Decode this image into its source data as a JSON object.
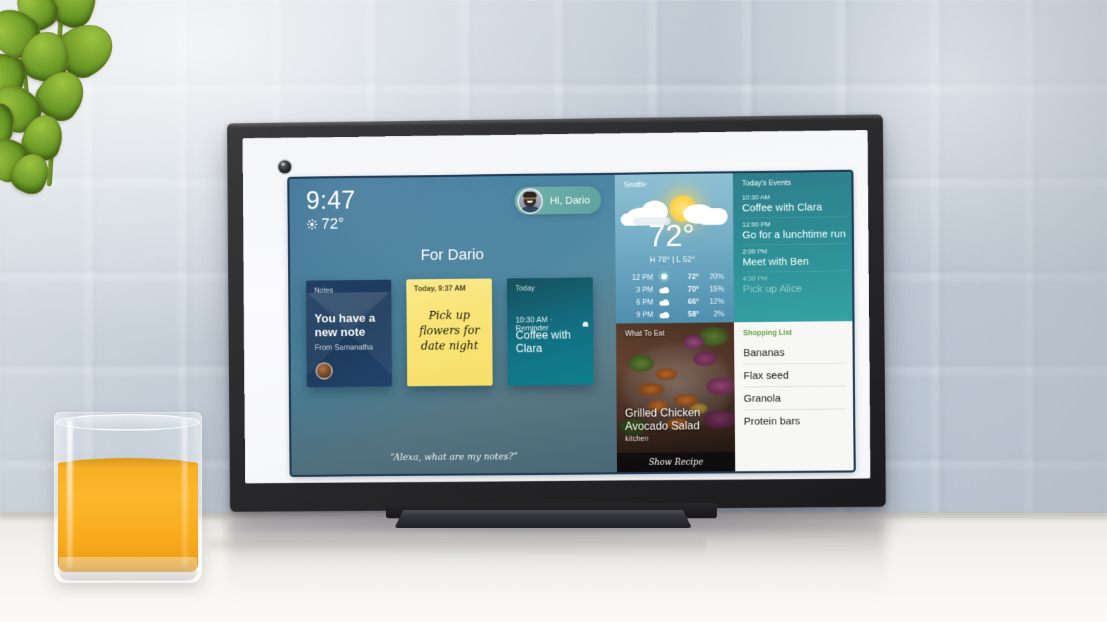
{
  "device": {
    "name": "Echo Show smart display",
    "camera_icon": "camera-lens-icon"
  },
  "screen": {
    "home": {
      "clock": {
        "time": "9:47",
        "temperature": "72°",
        "weather_icon": "sun-icon"
      },
      "greeting": {
        "text": "Hi, Dario",
        "avatar_icon": "user-avatar"
      },
      "section_title": "For Dario",
      "cards": [
        {
          "kicker": "Notes",
          "headline": "You have a new note",
          "subtext": "From Samanatha",
          "type": "note",
          "icon": "envelope-icon",
          "avatar_icon": "sender-avatar"
        },
        {
          "kicker": "Today, 9:37 AM",
          "headline": "Pick up flowers for date night",
          "type": "sticky-note"
        },
        {
          "kicker": "Today",
          "meta": "10:30 AM · Reminder",
          "headline": "Coffee with Clara",
          "type": "reminder",
          "icon": "bell-icon"
        }
      ],
      "voice_hint": "“Alexa, what are my notes?”"
    },
    "weather": {
      "city": "Seattle",
      "current_temp": "72°",
      "high_low": "H 78° | L 52°",
      "condition_icon": "partly-cloudy-sun-icon",
      "hourly": [
        {
          "time": "12 PM",
          "icon": "sun-icon",
          "temp": "72°",
          "precip": "20%"
        },
        {
          "time": "3 PM",
          "icon": "partly-cloudy-icon",
          "temp": "70°",
          "precip": "15%"
        },
        {
          "time": "6 PM",
          "icon": "partly-cloudy-icon",
          "temp": "66°",
          "precip": "12%"
        },
        {
          "time": "9 PM",
          "icon": "partly-cloudy-icon",
          "temp": "58°",
          "precip": "2%"
        }
      ]
    },
    "events": {
      "title": "Today's Events",
      "items": [
        {
          "time": "10:30 AM",
          "name": "Coffee with Clara",
          "faded": false
        },
        {
          "time": "12:00 PM",
          "name": "Go for a lunchtime run",
          "faded": false
        },
        {
          "time": "2:00 PM",
          "name": "Meet with Ben",
          "faded": false
        },
        {
          "time": "4:30 PM",
          "name": "Pick up Alice",
          "faded": true
        }
      ]
    },
    "recipe": {
      "kicker": "What To Eat",
      "title": "Grilled Chicken Avocado Salad",
      "source": "kitchen",
      "button": "Show Recipe"
    },
    "shopping": {
      "title": "Shopping List",
      "accent_color": "#5a9c3b",
      "items": [
        "Bananas",
        "Flax seed",
        "Granola",
        "Protein bars"
      ]
    }
  },
  "environment": {
    "plant": "jade-plant",
    "drink": "orange-juice-glass",
    "wall": "tiled-backsplash",
    "surface": "kitchen-counter"
  }
}
